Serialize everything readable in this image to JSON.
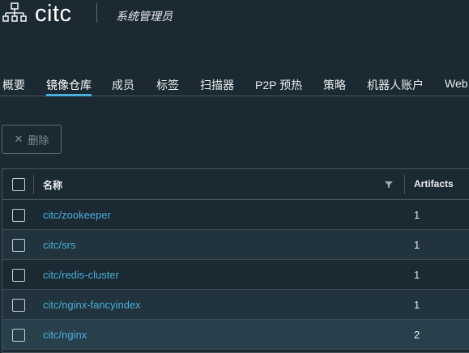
{
  "header": {
    "project_icon": "project-tree-icon",
    "project_name": "citc",
    "role": "系统管理员"
  },
  "tabs": [
    {
      "label": "概要"
    },
    {
      "label": "镜像仓库",
      "active": true
    },
    {
      "label": "成员"
    },
    {
      "label": "标签"
    },
    {
      "label": "扫描器"
    },
    {
      "label": "P2P 预热"
    },
    {
      "label": "策略"
    },
    {
      "label": "机器人账户"
    },
    {
      "label": "Web"
    }
  ],
  "toolbar": {
    "delete_icon": "close-icon",
    "delete_label": "删除"
  },
  "table": {
    "columns": [
      "名称",
      "Artifacts"
    ],
    "rows": [
      {
        "name": "citc/zookeeper",
        "artifacts": "1"
      },
      {
        "name": "citc/srs",
        "artifacts": "1"
      },
      {
        "name": "citc/redis-cluster",
        "artifacts": "1"
      },
      {
        "name": "citc/nginx-fancyindex",
        "artifacts": "1"
      },
      {
        "name": "citc/nginx",
        "artifacts": "2"
      }
    ]
  },
  "colors": {
    "background": "#1b2a32",
    "accent": "#49aeda",
    "border": "#485860"
  }
}
